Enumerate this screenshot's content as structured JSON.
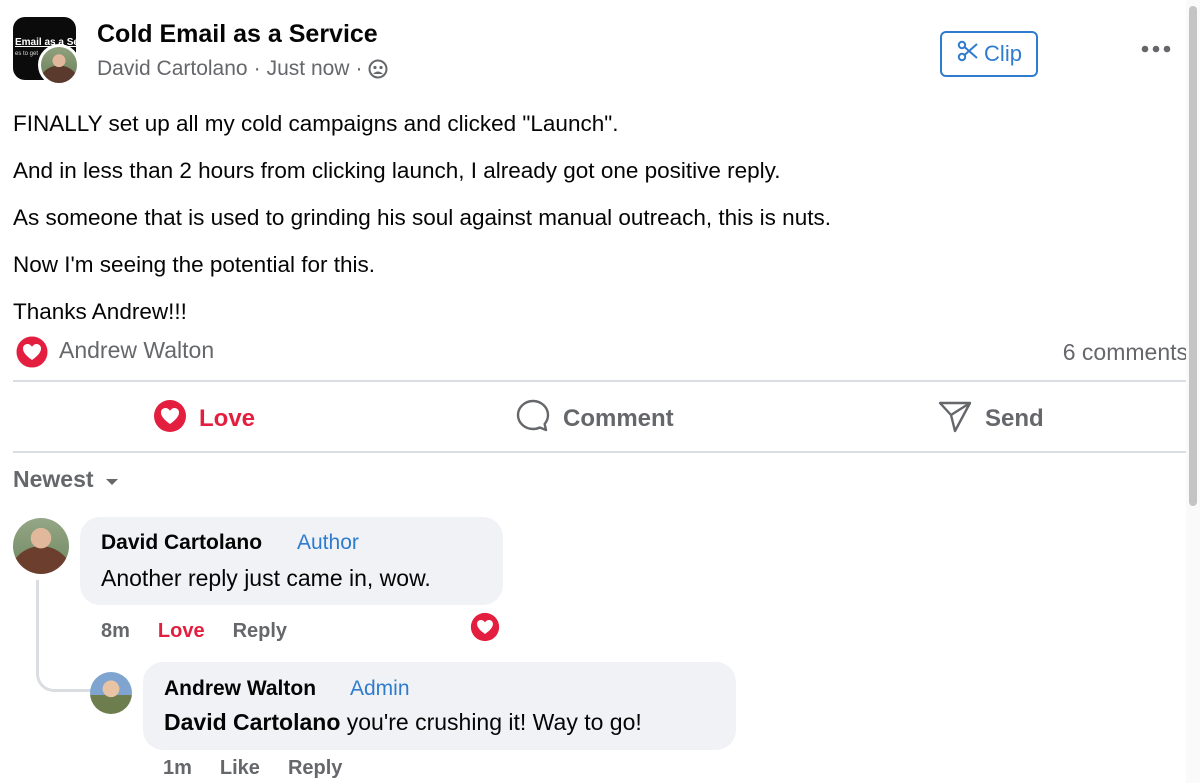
{
  "group": {
    "avatar_text": "Email as a Ser",
    "avatar_subtext": "es to get",
    "name": "Cold Email as a Service"
  },
  "post": {
    "author": "David Cartolano",
    "separator": "·",
    "time": "Just now",
    "visibility_icon": "group-icon",
    "clip_label": "Clip",
    "more_icon": "more-horizontal-icon",
    "paragraphs": [
      "FINALLY set up all my cold campaigns and clicked \"Launch\".",
      "And in less than 2 hours from clicking launch, I already got one positive reply.",
      "As someone that is used to grinding his soul against manual outreach, this is nuts.",
      "Now I'm seeing the potential for this.",
      "Thanks Andrew!!!"
    ],
    "reactor": "Andrew Walton",
    "comments_count": "6 comments"
  },
  "actions": {
    "love": "Love",
    "comment": "Comment",
    "send": "Send"
  },
  "sort_label": "Newest",
  "comments": [
    {
      "author": "David Cartolano",
      "badge": "Author",
      "text": "Another reply just came in, wow.",
      "time": "8m",
      "like_label": "Love",
      "reply_label": "Reply",
      "reaction": "love"
    },
    {
      "author": "Andrew Walton",
      "badge": "Admin",
      "mention": "David Cartolano",
      "text": " you're crushing it! Way to go!",
      "time": "1m",
      "like_label": "Like",
      "reply_label": "Reply"
    }
  ],
  "colors": {
    "love": "#e41e3f",
    "link_blue": "#2f7ccf",
    "muted": "#65676b",
    "bubble": "#f0f2f5"
  }
}
